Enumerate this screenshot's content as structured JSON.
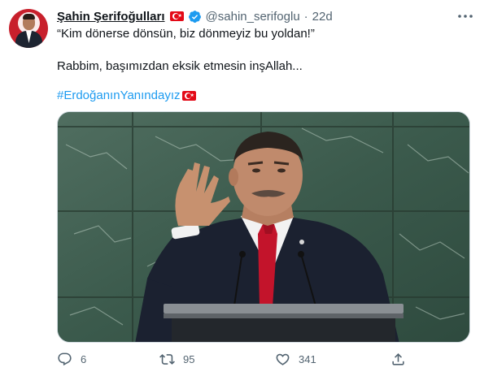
{
  "author": {
    "name": "Şahin Şerifoğulları",
    "handle": "@sahin_serifoglu",
    "separator": "·",
    "time": "22d",
    "flag_icon": "turkish-flag-icon",
    "verified_icon": "verified-badge-icon",
    "verified_color": "#1d9bf0",
    "avatar_colors": {
      "background": "#c8202c",
      "suit": "#1d2431"
    }
  },
  "tweet": {
    "line1": "“Kim dönerse dönsün, biz dönmeyiz bu yoldan!”",
    "line2": "Rabbim, başımızdan eksik etmesin inşAllah...",
    "hashtag": "#ErdoğanınYanındayız",
    "hashtag_color": "#1d9bf0"
  },
  "actions": {
    "reply": {
      "icon": "reply-icon",
      "count": "6"
    },
    "retweet": {
      "icon": "retweet-icon",
      "count": "95"
    },
    "like": {
      "icon": "heart-icon",
      "count": "341"
    },
    "share": {
      "icon": "share-icon"
    }
  },
  "colors": {
    "text": "#0f1419",
    "secondary": "#536471",
    "marble_dark": "#2f4a3e",
    "marble_light": "#5e7a6c",
    "suit": "#1b2130",
    "tie": "#c3142b",
    "skin": "#c08a6c"
  }
}
